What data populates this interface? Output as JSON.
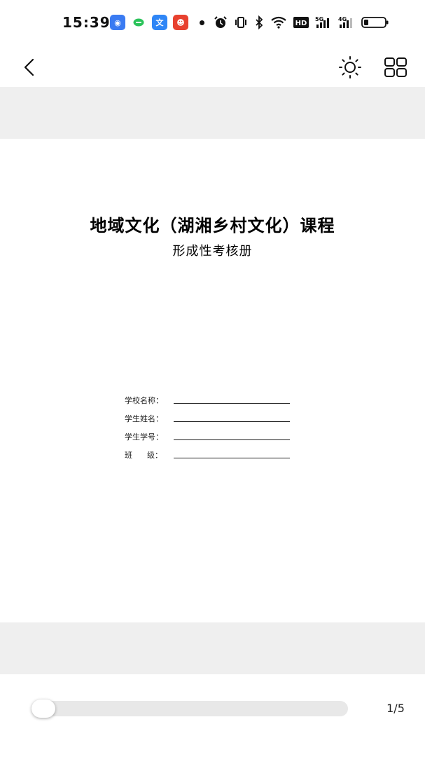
{
  "status_bar": {
    "time": "15:39",
    "app_icons": [
      {
        "name": "app-notification-icon-1",
        "color": "#3a7bf2",
        "glyph": "◉"
      },
      {
        "name": "chat-app-icon",
        "color": "#2bc35a",
        "glyph": "●"
      },
      {
        "name": "translate-app-icon",
        "color": "#2f86f6",
        "glyph": "文"
      },
      {
        "name": "app-notification-icon-4",
        "color": "#e8412f",
        "glyph": "☻"
      }
    ],
    "network_5g": "5G",
    "network_4g": "4G",
    "hd_label": "HD"
  },
  "nav": {
    "back_icon": "chevron-left-icon",
    "brightness_icon": "sun-icon",
    "grid_icon": "grid-icon"
  },
  "document": {
    "title": "地域文化（湖湘乡村文化）课程",
    "subtitle": "形成性考核册",
    "form_fields": [
      {
        "label": "学校名称："
      },
      {
        "label": "学生姓名："
      },
      {
        "label": "学生学号："
      },
      {
        "label": "班      级："
      }
    ]
  },
  "reader": {
    "current_page": 1,
    "total_pages": 5,
    "page_indicator": "1/5",
    "progress": 0.0
  }
}
